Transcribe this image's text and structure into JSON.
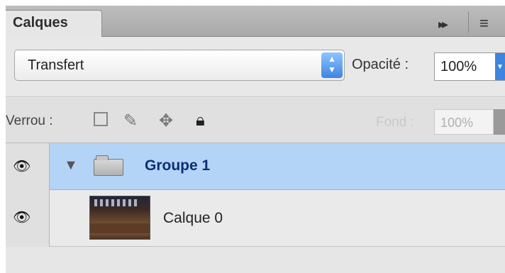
{
  "tab": {
    "title": "Calques"
  },
  "blend": {
    "mode": "Transfert",
    "opacity_label": "Opacité :",
    "opacity_value": "100%"
  },
  "lock": {
    "label": "Verrou :",
    "fill_label": "Fond :",
    "fill_value": "100%"
  },
  "layers": [
    {
      "name": "Groupe 1",
      "type": "group",
      "selected": true,
      "visible": true
    },
    {
      "name": "Calque 0",
      "type": "image",
      "selected": false,
      "visible": true
    }
  ]
}
